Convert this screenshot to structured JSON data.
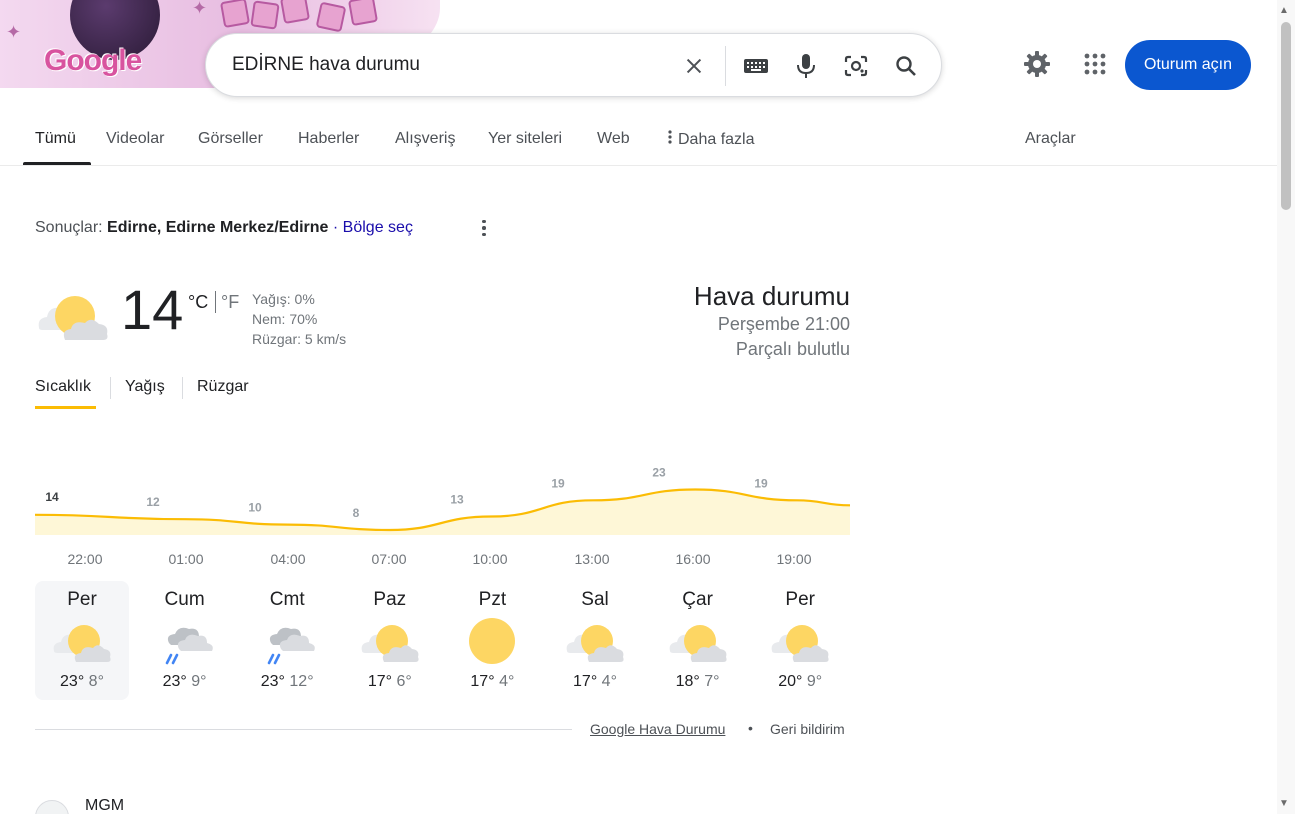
{
  "logo": {
    "text": "Google"
  },
  "search": {
    "query": "EDİRNE hava durumu"
  },
  "header": {
    "signin_label": "Oturum açın"
  },
  "tabs": [
    {
      "label": "Tümü",
      "active": true
    },
    {
      "label": "Videolar"
    },
    {
      "label": "Görseller"
    },
    {
      "label": "Haberler"
    },
    {
      "label": "Alışveriş"
    },
    {
      "label": "Yer siteleri"
    },
    {
      "label": "Web"
    },
    {
      "label": "Daha fazla"
    },
    {
      "label": "Araçlar"
    }
  ],
  "results": {
    "prefix": "Sonuçlar:",
    "location": "Edirne, Edirne Merkez/Edirne",
    "region_link": "· Bölge seç"
  },
  "weather": {
    "temperature": "14",
    "unit_c": "°C",
    "unit_f": "°F",
    "precip": "Yağış: 0%",
    "humidity": "Nem: 70%",
    "wind": "Rüzgar: 5 km/s",
    "title": "Hava durumu",
    "datetime": "Perşembe 21:00",
    "condition": "Parçalı bulutlu",
    "chart_tabs": [
      "Sıcaklık",
      "Yağış",
      "Rüzgar"
    ],
    "hour_labels": [
      "22:00",
      "01:00",
      "04:00",
      "07:00",
      "10:00",
      "13:00",
      "16:00",
      "19:00"
    ],
    "days": [
      {
        "name": "Per",
        "hi": "23°",
        "lo": "8°",
        "icon": "partly-cloudy"
      },
      {
        "name": "Cum",
        "hi": "23°",
        "lo": "9°",
        "icon": "rain"
      },
      {
        "name": "Cmt",
        "hi": "23°",
        "lo": "12°",
        "icon": "rain"
      },
      {
        "name": "Paz",
        "hi": "17°",
        "lo": "6°",
        "icon": "partly-cloudy"
      },
      {
        "name": "Pzt",
        "hi": "17°",
        "lo": "4°",
        "icon": "sunny"
      },
      {
        "name": "Sal",
        "hi": "17°",
        "lo": "4°",
        "icon": "partly-cloudy"
      },
      {
        "name": "Çar",
        "hi": "18°",
        "lo": "7°",
        "icon": "partly-cloudy"
      },
      {
        "name": "Per",
        "hi": "20°",
        "lo": "9°",
        "icon": "partly-cloudy"
      }
    ],
    "footer_link": "Google Hava Durumu",
    "footer_dot": "•",
    "feedback": "Geri bildirim"
  },
  "next_result": {
    "title": "MGM"
  },
  "colors": {
    "accent": "#fbbc04",
    "link": "#1a0dab",
    "signin": "#0b57d0"
  },
  "chart_data": {
    "type": "area",
    "x": [
      "22:00",
      "01:00",
      "04:00",
      "07:00",
      "10:00",
      "13:00",
      "16:00",
      "19:00"
    ],
    "series": [
      {
        "values": [
          14,
          12,
          10,
          8,
          13,
          19,
          23,
          19
        ]
      }
    ],
    "data_labels": [
      "14",
      "12",
      "10",
      "8",
      "13",
      "19",
      "23",
      "19"
    ],
    "xlabel": "",
    "ylabel": "",
    "grid": false
  }
}
